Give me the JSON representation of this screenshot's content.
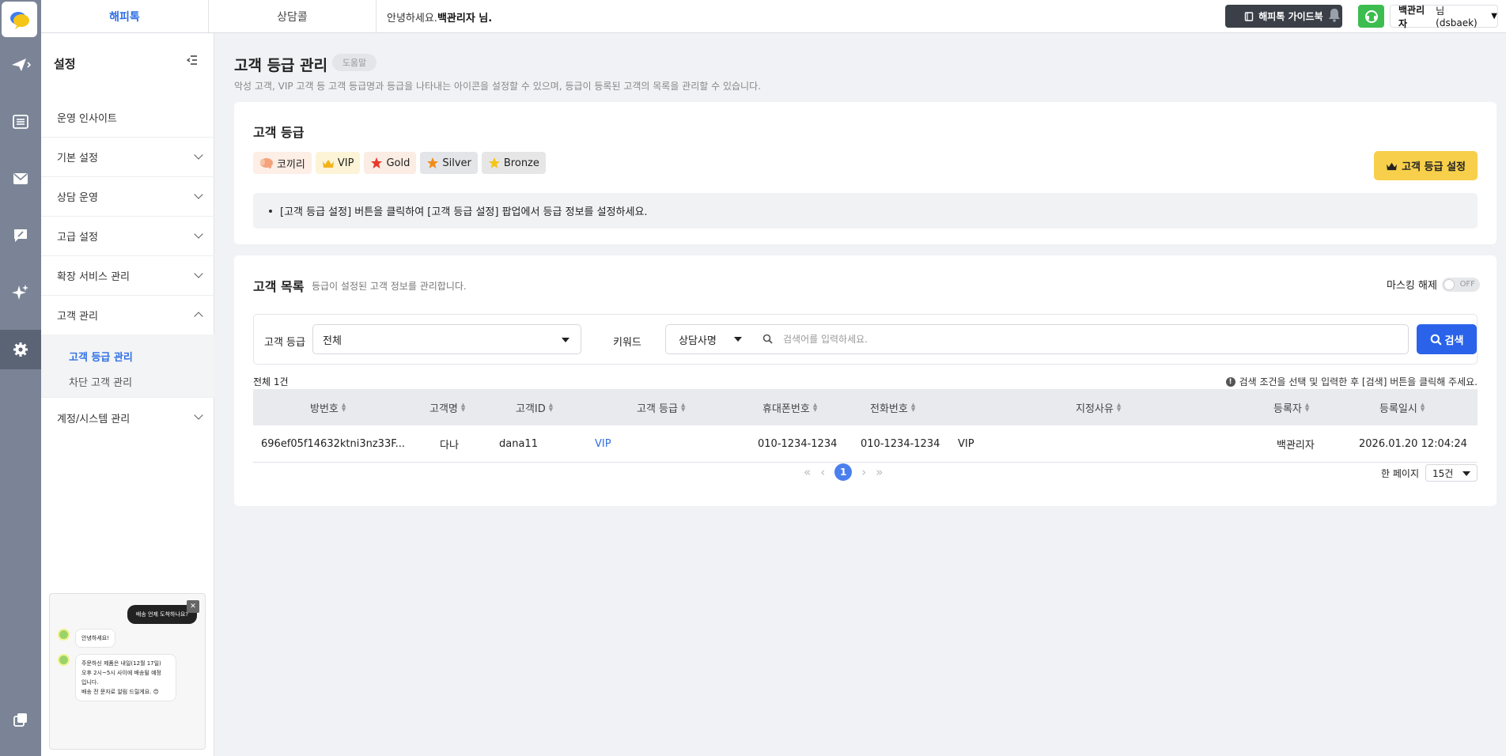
{
  "topbar": {
    "tabs": [
      "해피톡",
      "상담콜"
    ],
    "greeting_prefix": "안녕하세요.",
    "greeting_name": "백관리자 님.",
    "guide_label": "해피톡 가이드북",
    "user_name": "백관리자",
    "user_suffix": "님(dsbaek)"
  },
  "rail": {
    "icons": [
      "chat-logo-icon",
      "send-icon",
      "list-icon",
      "mail-icon",
      "edit-chat-icon",
      "sparkle-icon",
      "gear-icon",
      "copy-icon"
    ]
  },
  "sidebar": {
    "title": "설정",
    "items": [
      {
        "label": "운영 인사이트"
      },
      {
        "label": "기본 설정"
      },
      {
        "label": "상담 운영"
      },
      {
        "label": "고급 설정"
      },
      {
        "label": "확장 서비스 관리"
      },
      {
        "label": "고객 관리"
      },
      {
        "label": "계정/시스템 관리"
      }
    ],
    "sub_items": [
      "고객 등급 관리",
      "차단 고객 관리"
    ]
  },
  "chat_preview": {
    "top_message": "배송 언제 도착하나요?",
    "greeting": "안녕하세요!",
    "lines": [
      "주문하신 제품은 내일(12월 17일)",
      "오후 2시~5시 사이에 배송될 예정",
      "입니다.",
      "배송 전 문자로 알림 드릴게요. 😊"
    ]
  },
  "page": {
    "title": "고객 등급 관리",
    "help_badge": "도움말",
    "description": "악성 고객, VIP 고객 등 고객 등급명과 등급을 나타내는 아이콘을 설정할 수 있으며, 등급이 등록된 고객의 목록을 관리할 수 있습니다."
  },
  "grade_card": {
    "title": "고객 등급",
    "chips": [
      {
        "label": "코끼리",
        "icon": "elephant-icon",
        "color": "#f4a37c"
      },
      {
        "label": "VIP",
        "icon": "crown-icon",
        "color": "#f2b31b"
      },
      {
        "label": "Gold",
        "icon": "star-icon",
        "color": "#e83a2b"
      },
      {
        "label": "Silver",
        "icon": "star-icon",
        "color": "#f08c1a"
      },
      {
        "label": "Bronze",
        "icon": "star-icon",
        "color": "#f5c518"
      }
    ],
    "set_button": "고객 등급 설정",
    "notice": "[고객 등급 설정] 버튼을 클릭하여 [고객 등급 설정] 팝업에서 등급 정보를 설정하세요."
  },
  "list_card": {
    "title": "고객 목록",
    "subtitle": "등급이 설정된 고객 정보를 관리합니다.",
    "mask_label": "마스킹 해제",
    "toggle_text": "OFF",
    "filter": {
      "grade_label": "고객 등급",
      "grade_value": "전체",
      "keyword_label": "키워드",
      "keyword_type": "상담사명",
      "search_placeholder": "검색어를 입력하세요.",
      "search_button": "검색"
    },
    "total": "전체 1건",
    "hint": "검색 조건을 선택 및 입력한 후 [검색] 버튼을 클릭해 주세요.",
    "columns": [
      "방번호",
      "고객명",
      "고객ID",
      "고객 등급",
      "휴대폰번호",
      "전화번호",
      "지정사유",
      "등록자",
      "등록일시"
    ],
    "rows": [
      {
        "room": "696ef05f14632ktni3nz33F...",
        "name": "다나",
        "id": "dana11",
        "grade": "VIP",
        "mobile": "010-1234-1234",
        "phone": "010-1234-1234",
        "reason": "VIP",
        "registrar": "백관리자",
        "date": "2026.01.20 12:04:24"
      }
    ],
    "pagination": {
      "current": "1"
    },
    "per_page_label": "한 페이지",
    "per_page_value": "15건"
  }
}
